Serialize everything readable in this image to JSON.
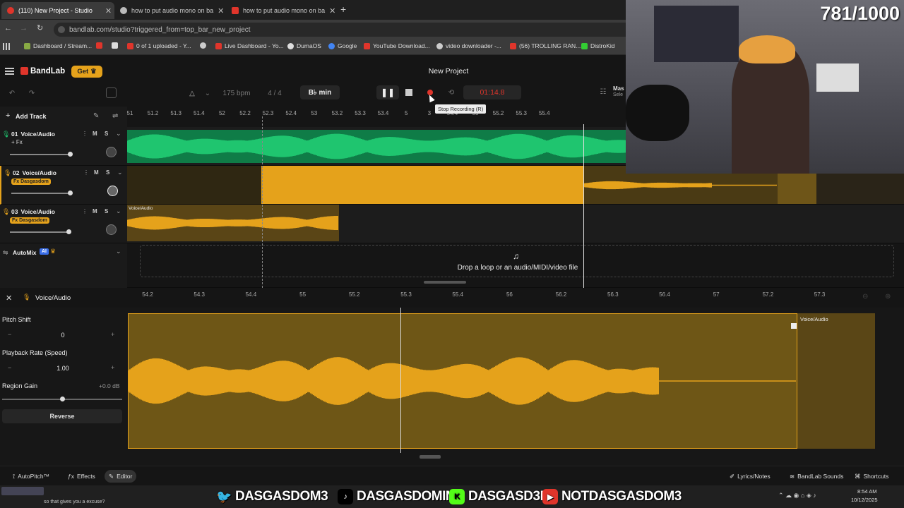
{
  "browser": {
    "tabs": [
      {
        "label": "(110) New Project - Studio",
        "active": true
      },
      {
        "label": "how to put audio mono on ba",
        "active": false
      },
      {
        "label": "how to put audio mono on ba",
        "active": false
      }
    ],
    "new_tab_symbol": "+",
    "url": "bandlab.com/studio?triggered_from=top_bar_new_project",
    "bookmarks": [
      "Dashboard / Stream...",
      "0 of 1 uploaded - Y...",
      "Live Dashboard - Yo...",
      "DumaOS",
      "Google",
      "YouTube Download...",
      "video downloader -...",
      "(56) TROLLING RAN...",
      "DistroKid"
    ]
  },
  "app": {
    "logo": "BandLab",
    "get_button": "Get",
    "project_title": "New Project",
    "bpm": "175 bpm",
    "time_sig": "4 / 4",
    "key": "B♭ min",
    "time": "01:14.8",
    "tooltip": "Stop Recording (R)",
    "master_label": "Mas",
    "master_sub": "Sele",
    "add_track": "Add Track",
    "record_color": "#e0352b",
    "accent": "#e5a21b",
    "green": "#1fc56f"
  },
  "ruler_top": [
    "51",
    "51.2",
    "51.3",
    "51.4",
    "52",
    "52.2",
    "52.3",
    "52.4",
    "53",
    "53.2",
    "53.3",
    "53.4",
    "5",
    "3",
    "54.4",
    "55",
    "55.2",
    "55.3",
    "55.4"
  ],
  "tracks": [
    {
      "num": "01",
      "name": "Voice/Audio",
      "fx": "+ Fx",
      "m": "M",
      "s": "S"
    },
    {
      "num": "02",
      "name": "Voice/Audio",
      "fx": "Fx Dasgasdom",
      "m": "M",
      "s": "S"
    },
    {
      "num": "03",
      "name": "Voice/Audio",
      "fx": "Fx Dasgasdom",
      "m": "M",
      "s": "S",
      "region_label": "Voice/Audio"
    }
  ],
  "automix": {
    "label": "AutoMix",
    "badge": "AI"
  },
  "drop_zone": "Drop a loop or an audio/MIDI/video file",
  "editor": {
    "title": "Voice/Audio",
    "pitch_shift_label": "Pitch Shift",
    "pitch_shift_value": "0",
    "playback_rate_label": "Playback Rate (Speed)",
    "playback_rate_value": "1.00",
    "region_gain_label": "Region Gain",
    "region_gain_value": "+0.0 dB",
    "reverse_button": "Reverse",
    "region_label": "Voice/Audio",
    "ruler": [
      "54.2",
      "54.3",
      "54.4",
      "55",
      "55.2",
      "55.3",
      "55.4",
      "56",
      "56.2",
      "56.3",
      "56.4",
      "57",
      "57.2",
      "57.3"
    ],
    "minus": "−",
    "plus": "+"
  },
  "footer": {
    "autopitch": "AutoPitch™",
    "effects": "Effects",
    "editor": "Editor",
    "lyrics": "Lyrics/Notes",
    "sounds": "BandLab Sounds",
    "shortcuts": "Shortcuts"
  },
  "overlay": {
    "counter": "781/1000",
    "socials": [
      "DASGASDOM3",
      "DASGASDOMINI",
      "DASGASD3M",
      "NOTDASGASDOM3"
    ],
    "chat": "so that gives you a excuse?",
    "clock_time": "8:54 AM",
    "clock_date": "10/12/2025"
  }
}
